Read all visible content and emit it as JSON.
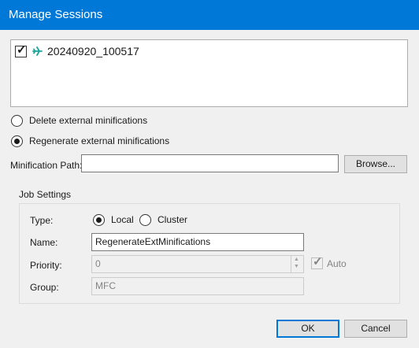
{
  "window": {
    "title": "Manage Sessions"
  },
  "sessions": [
    {
      "name": "20240920_100517",
      "checked": true,
      "icon": "session-airplane-icon"
    }
  ],
  "mode": {
    "delete_label": "Delete external minifications",
    "regenerate_label": "Regenerate external minifications",
    "selected": "regenerate"
  },
  "path": {
    "label": "Minification Path:",
    "value": "",
    "browse_label": "Browse..."
  },
  "job": {
    "title": "Job Settings",
    "type_label": "Type:",
    "local_label": "Local",
    "cluster_label": "Cluster",
    "type_selected": "local",
    "name_label": "Name:",
    "name_value": "RegenerateExtMinifications",
    "priority_label": "Priority:",
    "priority_value": "0",
    "auto_label": "Auto",
    "auto_checked": true,
    "group_label": "Group:",
    "group_value": "MFC"
  },
  "footer": {
    "ok_label": "OK",
    "cancel_label": "Cancel"
  },
  "colors": {
    "accent": "#0078d7",
    "icon": "#1ba39c"
  }
}
